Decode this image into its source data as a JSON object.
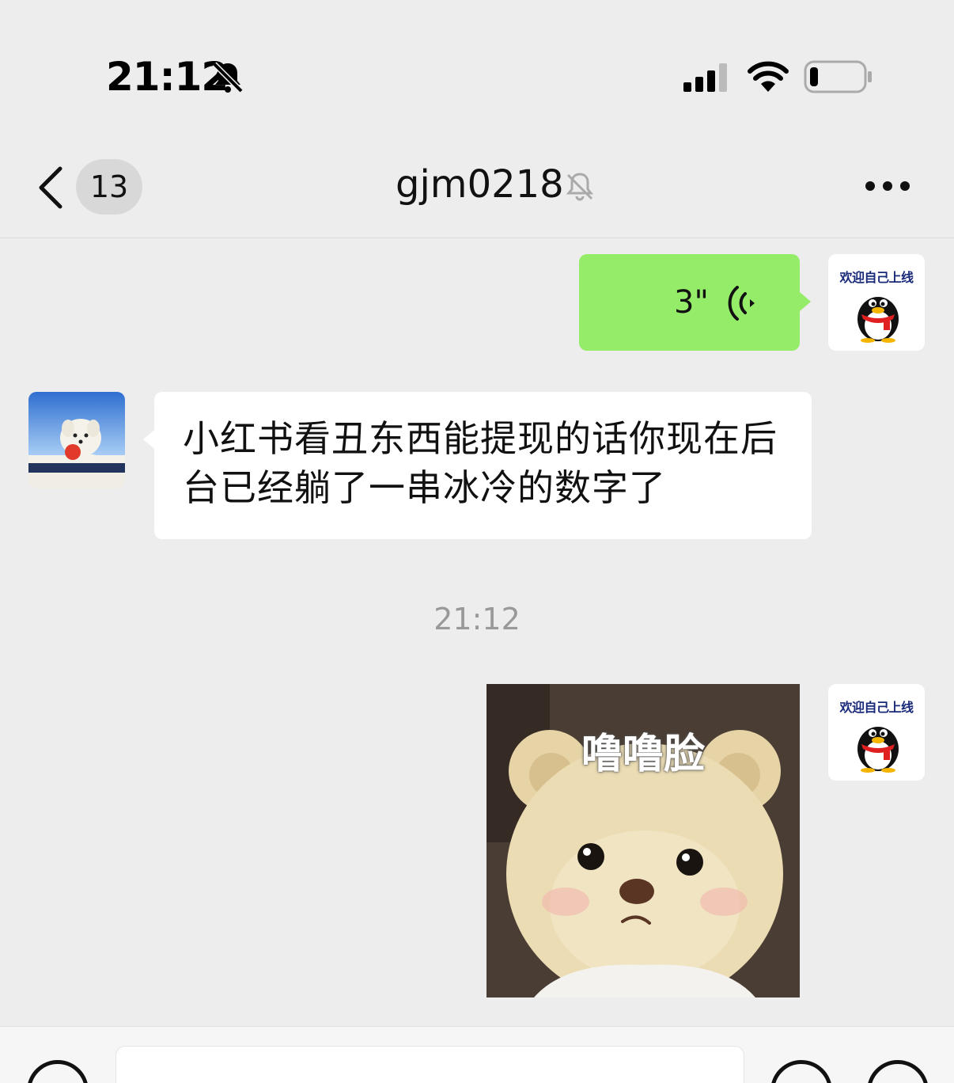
{
  "status_bar": {
    "time": "21:12",
    "mute_icon": "bell-slash-icon",
    "signal_icon": "cellular-signal-icon",
    "wifi_icon": "wifi-icon",
    "battery_icon": "battery-low-icon",
    "battery_level": 0.12
  },
  "nav": {
    "back_icon": "chevron-left-icon",
    "unread_count": "13",
    "title": "gjm0218",
    "title_icon": "bell-slash-icon",
    "more_icon": "more-dots-icon"
  },
  "messages": [
    {
      "type": "voice",
      "sender": "me",
      "duration": "3\"",
      "icon": "voice-wave-icon",
      "avatar_text": "欢迎自己上线",
      "avatar_icon": "qq-penguin-icon"
    },
    {
      "type": "text",
      "sender": "other",
      "text": "小红书看丑东西能提现的话你现在后台已经躺了一串冰冷的数字了",
      "avatar_icon": "dog-with-apple-photo"
    },
    {
      "type": "timestamp",
      "text": "21:12"
    },
    {
      "type": "sticker",
      "sender": "me",
      "caption": "噜噜脸",
      "image": "teddy-bear-sticker",
      "avatar_text": "欢迎自己上线",
      "avatar_icon": "qq-penguin-icon"
    }
  ],
  "input_bar": {
    "voice_icon": "voice-input-icon",
    "emoji_icon": "emoji-icon",
    "plus_icon": "plus-icon"
  },
  "colors": {
    "background": "#ededed",
    "my_bubble": "#95ec69",
    "other_bubble": "#ffffff",
    "timestamp": "#999999"
  }
}
